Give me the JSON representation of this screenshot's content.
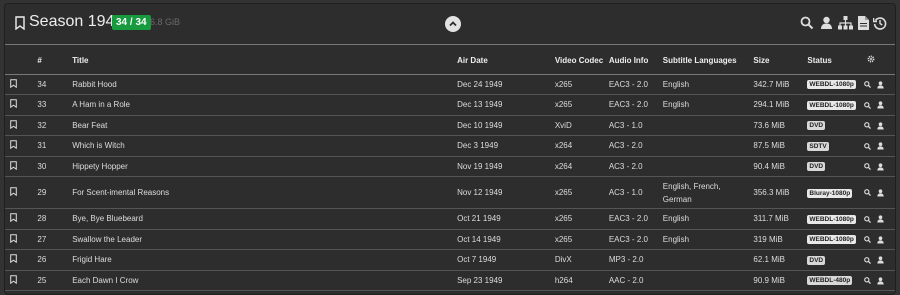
{
  "header": {
    "title": "Season 1949",
    "episode_count": "34 / 34",
    "size": "6.8 GiB"
  },
  "columns": [
    "#",
    "Title",
    "Air Date",
    "Video Codec",
    "Audio Info",
    "Subtitle Languages",
    "Size",
    "Status"
  ],
  "episodes": [
    {
      "num": "34",
      "title": "Rabbit Hood",
      "air": "Dec 24 1949",
      "vc": "x265",
      "audio": "EAC3 - 2.0",
      "subs": "English",
      "size": "342.7 MiB",
      "status": "WEBDL-1080p"
    },
    {
      "num": "33",
      "title": "A Ham in a Role",
      "air": "Dec 13 1949",
      "vc": "x265",
      "audio": "EAC3 - 2.0",
      "subs": "English",
      "size": "294.1 MiB",
      "status": "WEBDL-1080p"
    },
    {
      "num": "32",
      "title": "Bear Feat",
      "air": "Dec 10 1949",
      "vc": "XviD",
      "audio": "AC3 - 1.0",
      "subs": "",
      "size": "73.6 MiB",
      "status": "DVD"
    },
    {
      "num": "31",
      "title": "Which is Witch",
      "air": "Dec 3 1949",
      "vc": "x264",
      "audio": "AC3 - 2.0",
      "subs": "",
      "size": "87.5 MiB",
      "status": "SDTV"
    },
    {
      "num": "30",
      "title": "Hippety Hopper",
      "air": "Nov 19 1949",
      "vc": "x264",
      "audio": "AC3 - 2.0",
      "subs": "",
      "size": "90.4 MiB",
      "status": "DVD"
    },
    {
      "num": "29",
      "title": "For Scent-imental Reasons",
      "air": "Nov 12 1949",
      "vc": "x265",
      "audio": "AC3 - 1.0",
      "subs1": "English, French,",
      "subs2": "German",
      "size": "356.3 MiB",
      "status": "Bluray-1080p"
    },
    {
      "num": "28",
      "title": "Bye, Bye Bluebeard",
      "air": "Oct 21 1949",
      "vc": "x265",
      "audio": "EAC3 - 2.0",
      "subs": "English",
      "size": "311.7 MiB",
      "status": "WEBDL-1080p"
    },
    {
      "num": "27",
      "title": "Swallow the Leader",
      "air": "Oct 14 1949",
      "vc": "x265",
      "audio": "EAC3 - 2.0",
      "subs": "English",
      "size": "319 MiB",
      "status": "WEBDL-1080p"
    },
    {
      "num": "26",
      "title": "Frigid Hare",
      "air": "Oct 7 1949",
      "vc": "DivX",
      "audio": "MP3 - 2.0",
      "subs": "",
      "size": "62.1 MiB",
      "status": "DVD"
    },
    {
      "num": "25",
      "title": "Each Dawn I Crow",
      "air": "Sep 23 1949",
      "vc": "h264",
      "audio": "AAC - 2.0",
      "subs": "",
      "size": "90.9 MiB",
      "status": "WEBDL-480p"
    }
  ],
  "icons": {
    "bookmark": "bookmark-icon",
    "search": "search-icon",
    "user": "user-icon",
    "organize": "sitemap-icon",
    "file": "file-icon",
    "history": "history-icon",
    "settings": "gear-icon",
    "collapse": "chevron-up-icon"
  },
  "colors": {
    "badge_green": "#189a3f",
    "background": "#2d2d2d"
  }
}
